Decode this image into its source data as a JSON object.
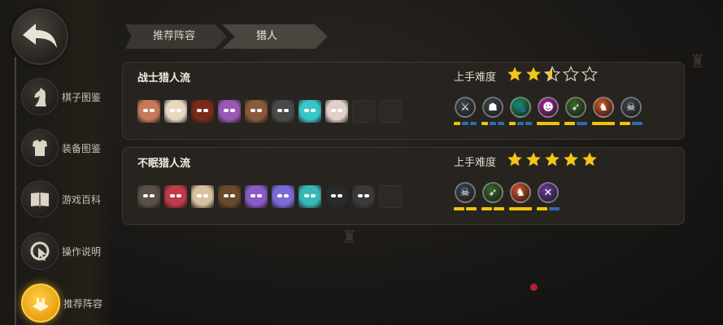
{
  "sidebar": {
    "items": [
      {
        "label": "棋子图鉴",
        "icon": "chess-knight-icon"
      },
      {
        "label": "装备图鉴",
        "icon": "armor-icon"
      },
      {
        "label": "游戏百科",
        "icon": "book-icon"
      },
      {
        "label": "操作说明",
        "icon": "cursor-icon"
      },
      {
        "label": "推荐阵容",
        "icon": "formation-icon",
        "active": true
      }
    ]
  },
  "breadcrumb": {
    "first": "推荐阵容",
    "second": "猎人"
  },
  "cards": [
    {
      "title": "战士猎人流",
      "difficulty_label": "上手难度",
      "difficulty": 2.5,
      "hero_colors": [
        "#c97a5a",
        "#e8d8c0",
        "#7a2a1a",
        "#9b59b6",
        "#8b5a3a",
        "#4a4a4a",
        "#3ac6c8",
        "#e0d0c8"
      ],
      "empty_slots": 2,
      "synergies": [
        {
          "icon": "axe-icon",
          "color": "#3a4852",
          "glyph": "⚔",
          "level": 1,
          "max": 3
        },
        {
          "icon": "helmet-icon",
          "color": "#3a4852",
          "glyph": "☗",
          "level": 1,
          "max": 3
        },
        {
          "icon": "paw-icon",
          "color": "#1a9a5a",
          "glyph": "🐾",
          "level": 1,
          "max": 3
        },
        {
          "icon": "mask-icon",
          "color": "#b02aa8",
          "glyph": "☻",
          "level": 1,
          "max": 1
        },
        {
          "icon": "bow-icon",
          "color": "#3a6a2a",
          "glyph": "➶",
          "level": 1,
          "max": 2
        },
        {
          "icon": "fox-icon",
          "color": "#d8582a",
          "glyph": "♞",
          "level": 1,
          "max": 1
        },
        {
          "icon": "skull-icon",
          "color": "#3a4852",
          "glyph": "☠",
          "level": 1,
          "max": 2
        }
      ]
    },
    {
      "title": "不眠猎人流",
      "difficulty_label": "上手难度",
      "difficulty": 5,
      "hero_colors": [
        "#5a5048",
        "#c03a4a",
        "#d8c0a0",
        "#6a4a2a",
        "#8a5ac8",
        "#7a6ad8",
        "#38b8b8",
        "#2a2a2a",
        "#3a3a3a"
      ],
      "empty_slots": 1,
      "synergies": [
        {
          "icon": "skull-icon",
          "color": "#3a4852",
          "glyph": "☠",
          "level": 2,
          "max": 2
        },
        {
          "icon": "bow-icon",
          "color": "#3a6a2a",
          "glyph": "➶",
          "level": 2,
          "max": 2
        },
        {
          "icon": "fox-icon",
          "color": "#d8582a",
          "glyph": "♞",
          "level": 1,
          "max": 1
        },
        {
          "icon": "fishbone-icon",
          "color": "#6a3aa8",
          "glyph": "✕",
          "level": 1,
          "max": 2
        }
      ]
    }
  ],
  "colors": {
    "accent": "#f2c20a",
    "bar_off": "#2e6bb0",
    "star": "#f5c518"
  }
}
